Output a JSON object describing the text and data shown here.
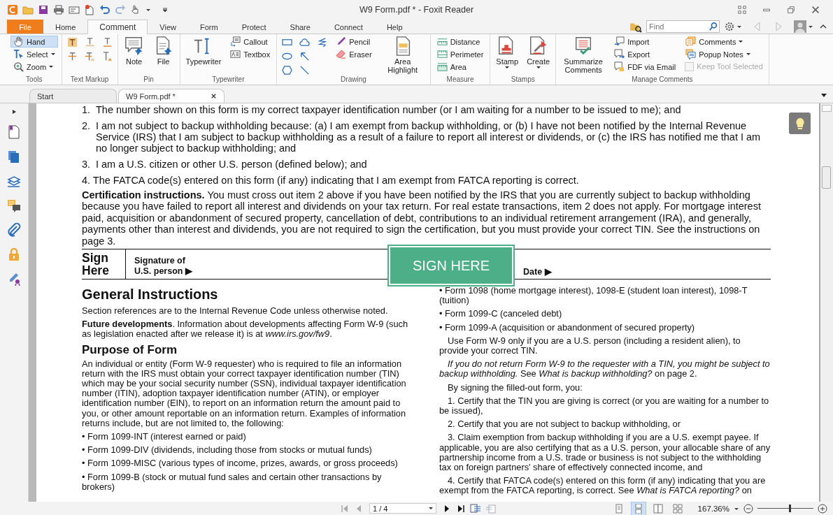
{
  "window": {
    "title": "W9 Form.pdf * - Foxit Reader"
  },
  "ribbon_tabs": [
    {
      "label": "File",
      "kind": "file",
      "selected": false
    },
    {
      "label": "Home",
      "kind": "tab",
      "selected": false
    },
    {
      "label": "Comment",
      "kind": "tab",
      "selected": true
    },
    {
      "label": "View",
      "kind": "tab",
      "selected": false
    },
    {
      "label": "Form",
      "kind": "tab",
      "selected": false
    },
    {
      "label": "Protect",
      "kind": "tab",
      "selected": false
    },
    {
      "label": "Share",
      "kind": "tab",
      "selected": false
    },
    {
      "label": "Connect",
      "kind": "tab",
      "selected": false
    },
    {
      "label": "Help",
      "kind": "tab",
      "selected": false
    }
  ],
  "find": {
    "placeholder": "Find"
  },
  "ribbon_groups": [
    {
      "label": "Tools",
      "columns": [
        [
          {
            "kind": "small",
            "label": "Hand",
            "selected": true
          },
          {
            "kind": "small",
            "label": "Select",
            "selected": false,
            "dropdown": true
          },
          {
            "kind": "small",
            "label": "Zoom",
            "selected": false,
            "dropdown": true
          }
        ]
      ]
    },
    {
      "label": "Text Markup",
      "columns": [
        [
          {
            "kind": "icon"
          },
          {
            "kind": "icon"
          }
        ],
        [
          {
            "kind": "icon"
          },
          {
            "kind": "icon"
          }
        ],
        [
          {
            "kind": "icon"
          },
          {
            "kind": "icon"
          }
        ]
      ]
    },
    {
      "label": "Pin",
      "columns": [
        [
          {
            "kind": "large",
            "label": "Note"
          }
        ],
        [
          {
            "kind": "large",
            "label": "File"
          }
        ]
      ]
    },
    {
      "label": "Typewriter",
      "columns": [
        [
          {
            "kind": "large",
            "label": "Typewriter"
          }
        ],
        [
          {
            "kind": "small",
            "label": "Callout"
          },
          {
            "kind": "small",
            "label": "Textbox"
          }
        ]
      ]
    },
    {
      "label": "Drawing",
      "columns": [
        [
          {
            "kind": "icon"
          },
          {
            "kind": "icon"
          },
          {
            "kind": "icon"
          }
        ],
        [
          {
            "kind": "icon"
          },
          {
            "kind": "icon"
          },
          {
            "kind": "icon"
          }
        ],
        [
          {
            "kind": "icon"
          }
        ],
        [
          {
            "kind": "small",
            "label": "Pencil"
          },
          {
            "kind": "small",
            "label": "Eraser"
          }
        ],
        [
          {
            "kind": "large",
            "label": "Area Highlight"
          }
        ]
      ]
    },
    {
      "label": "Measure",
      "columns": [
        [
          {
            "kind": "small",
            "label": "Distance"
          },
          {
            "kind": "small",
            "label": "Perimeter"
          },
          {
            "kind": "small",
            "label": "Area"
          }
        ]
      ]
    },
    {
      "label": "Stamps",
      "columns": [
        [
          {
            "kind": "large",
            "label": "Stamp",
            "dropdown": true
          }
        ],
        [
          {
            "kind": "large",
            "label": "Create",
            "dropdown": true
          }
        ]
      ]
    },
    {
      "label": "Manage Comments",
      "columns": [
        [
          {
            "kind": "large",
            "label": "Summarize Comments"
          }
        ],
        [
          {
            "kind": "small",
            "label": "Import"
          },
          {
            "kind": "small",
            "label": "Export"
          },
          {
            "kind": "small",
            "label": "FDF via Email"
          }
        ],
        [
          {
            "kind": "small",
            "label": "Comments",
            "dropdown": true
          },
          {
            "kind": "small",
            "label": "Popup Notes",
            "dropdown": true
          },
          {
            "kind": "checkbox",
            "label": "Keep Tool Selected",
            "checked": false,
            "disabled": true
          }
        ]
      ]
    }
  ],
  "document_tabs": [
    {
      "label": "Start",
      "selected": false,
      "closable": false
    },
    {
      "label": "W9 Form.pdf *",
      "selected": true,
      "closable": true
    }
  ],
  "document": {
    "statements": [
      {
        "kind": "hanging",
        "number": "1.",
        "text": "The number shown on this form is my correct taxpayer identification number (or I am waiting for a number to be issued to me); and"
      },
      {
        "kind": "hanging",
        "number": "2.",
        "text": "I am not subject to backup withholding because: (a) I am exempt from backup withholding, or (b) I have not been notified by the Internal Revenue Service (IRS) that I am subject to backup withholding as a result of a failure to report all interest or dividends, or (c) the IRS has notified me that I am no longer subject to backup withholding; and"
      },
      {
        "kind": "hanging",
        "number": "3.",
        "text": "I am a U.S. citizen or other U.S. person (defined below); and"
      },
      {
        "kind": "inline",
        "number": "4.",
        "text": "The FATCA code(s) entered on this form (if any) indicating that I am exempt from FATCA reporting is correct."
      }
    ],
    "certification": "**Certification instructions.** You must cross out item 2 above if you have been notified by the IRS that you are currently subject to backup withholding because you have failed to report all interest and dividends on your tax return. For real estate transactions, item 2 does not apply. For mortgage interest paid, acquisition or abandonment of secured property, cancellation of debt, contributions to an individual retirement arrangement (IRA), and generally, payments other than interest and dividends, you are not required to sign the certification, but you must provide your correct TIN. See the instructions on page 3.",
    "sign": {
      "heading": "Sign Here",
      "signature_label": "Signature of U.S. person ▶",
      "date_label": "Date ▶",
      "button": "SIGN HERE"
    },
    "left_column": [
      {
        "kind": "heading",
        "text": "General Instructions"
      },
      {
        "kind": "paragraph",
        "text": "Section references are to the Internal Revenue Code unless otherwise noted."
      },
      {
        "kind": "paragraph",
        "text": "**Future developments**. Information about developments affecting Form W-9 (such as legislation enacted after we release it) is at *www.irs.gov/fw9*."
      },
      {
        "kind": "subheading",
        "text": "Purpose of Form"
      },
      {
        "kind": "paragraph",
        "text": "An individual or entity (Form W-9 requester) who is required to file an information return with the IRS must obtain your correct taxpayer identification number (TIN) which may be your social security number (SSN), individual taxpayer identification number (ITIN), adoption taxpayer identification number (ATIN), or employer identification number (EIN), to report on an information return the amount paid to you, or other amount reportable on an information return. Examples of information returns include, but are not limited to, the following:"
      },
      {
        "kind": "bullet",
        "text": "• Form 1099-INT (interest earned or paid)"
      },
      {
        "kind": "bullet",
        "text": "• Form 1099-DIV (dividends, including those from stocks or mutual funds)"
      },
      {
        "kind": "bullet",
        "text": "• Form 1099-MISC (various types of income, prizes, awards, or gross proceeds)"
      },
      {
        "kind": "bullet",
        "text": "• Form 1099-B (stock or mutual fund sales and certain other transactions by brokers)"
      }
    ],
    "right_column": [
      {
        "kind": "bullet",
        "text": "• Form 1098 (home mortgage interest), 1098-E (student loan interest), 1098-T (tuition)"
      },
      {
        "kind": "bullet",
        "text": "• Form 1099-C (canceled debt)"
      },
      {
        "kind": "bullet",
        "text": "• Form 1099-A (acquisition or abandonment of secured property)"
      },
      {
        "kind": "indented",
        "text": "Use Form W-9 only if you are a U.S. person (including a resident alien), to provide your correct TIN."
      },
      {
        "kind": "indented",
        "text": "*If you do not return Form W-9 to the requester with a TIN, you might be subject to backup withholding.* See *What is backup withholding?* on page 2."
      },
      {
        "kind": "indented",
        "text": "By signing the filled-out form, you:"
      },
      {
        "kind": "indented",
        "text": "1. Certify that the TIN you are giving is correct (or you are waiting for a number to be issued),"
      },
      {
        "kind": "indented",
        "text": "2. Certify that you are not subject to backup withholding, or"
      },
      {
        "kind": "indented",
        "text": "3. Claim exemption from backup withholding if you are a U.S. exempt payee. If applicable, you are also certifying that as a U.S. person, your allocable share of any partnership income from a U.S. trade or business is not subject to the withholding tax on foreign partners' share of effectively connected income, and"
      },
      {
        "kind": "indented",
        "text": "4. Certify that FATCA code(s) entered on this form (if any) indicating that you are exempt from the FATCA reporting, is correct. See *What is FATCA reporting?* on"
      }
    ]
  },
  "status_bar": {
    "page": "1 / 4",
    "view_modes": [
      {
        "selected": false
      },
      {
        "selected": true
      },
      {
        "selected": false
      },
      {
        "selected": false
      }
    ],
    "zoom": "167.36%",
    "zoom_slider": {
      "level": 0.57
    }
  }
}
